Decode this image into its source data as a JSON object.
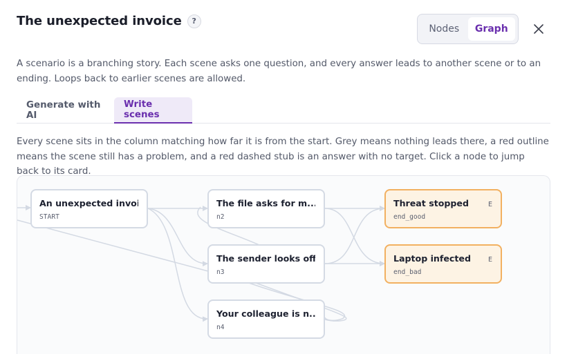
{
  "header": {
    "title": "The unexpected invoice",
    "help_label": "?"
  },
  "view_toggle": {
    "options": [
      "Nodes",
      "Graph"
    ],
    "active": "Graph"
  },
  "intro": "A scenario is a branching story. Each scene asks one question, and every answer leads to another scene or to an ending. Loops back to earlier scenes are allowed.",
  "tabs": [
    {
      "label": "Generate with AI",
      "active": false
    },
    {
      "label": "Write scenes",
      "active": true
    }
  ],
  "explain": "Every scene sits in the column matching how far it is from the start. Grey means nothing leads there, a red outline means the scene still has a problem, and a red dashed stub is an answer with no target. Click a node to jump back to its card.",
  "graph": {
    "nodes": [
      {
        "title": "An unexpected invoice",
        "id": "START",
        "kind": "scene"
      },
      {
        "title": "The file asks for m...",
        "id": "n2",
        "kind": "scene"
      },
      {
        "title": "The sender looks off",
        "id": "n3",
        "kind": "scene"
      },
      {
        "title": "Your colleague is n...",
        "id": "n4",
        "kind": "scene"
      },
      {
        "title": "Threat stopped",
        "id": "end_good",
        "kind": "ending",
        "tag": "E"
      },
      {
        "title": "Laptop infected",
        "id": "end_bad",
        "kind": "ending",
        "tag": "E"
      }
    ]
  },
  "colors": {
    "accent": "#6a2fae",
    "edge": "#d3d9e3",
    "ending_fill": "#fdf3e4",
    "ending_border": "#f2b060"
  },
  "icons": {
    "close": "close-icon",
    "help": "help-icon"
  }
}
